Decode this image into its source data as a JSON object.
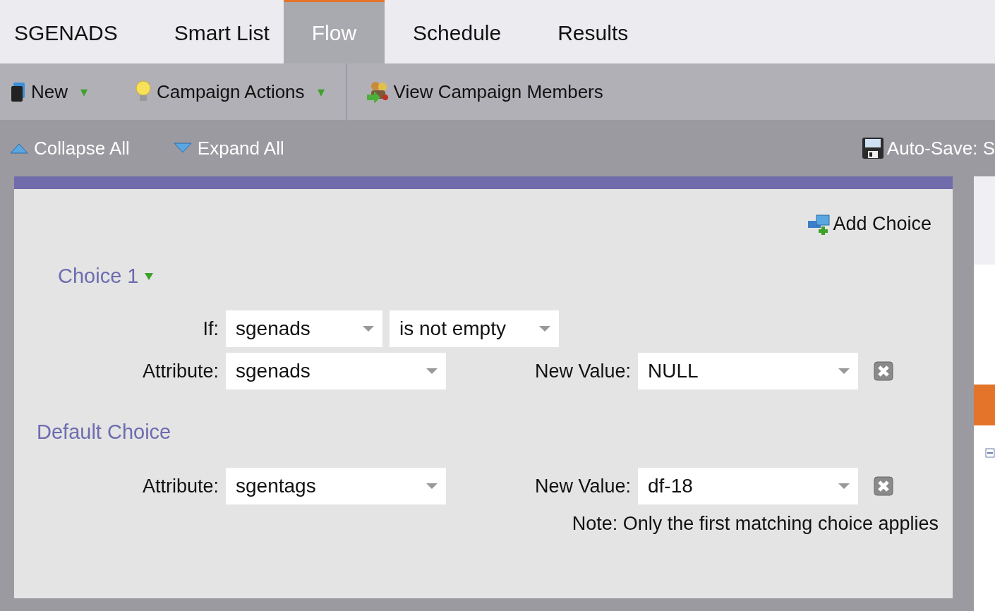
{
  "tabs": [
    {
      "label": "SGENADS",
      "selected": false
    },
    {
      "label": "Smart List",
      "selected": false
    },
    {
      "label": "Flow",
      "selected": true
    },
    {
      "label": "Schedule",
      "selected": false
    },
    {
      "label": "Results",
      "selected": false
    }
  ],
  "toolbar": [
    {
      "kind": "menu",
      "label": "New",
      "caret": "▾"
    },
    {
      "kind": "menu",
      "label": "Campaign Actions",
      "caret": "▾"
    },
    {
      "kind": "link",
      "label": "View Campaign Members"
    }
  ],
  "view_bar": {
    "collapse": "Collapse All",
    "expand": "Expand All",
    "autosave": "Auto-Save: S"
  },
  "panel": {
    "add_choice": "Add Choice",
    "choices": [
      {
        "title": "Choice 1",
        "if_label": "If:",
        "if_field": "sgenads",
        "if_operator": "is not empty",
        "attribute_label": "Attribute:",
        "attribute": "sgenads",
        "new_value_label": "New Value:",
        "new_value": "NULL"
      }
    ],
    "default": {
      "title": "Default Choice",
      "attribute_label": "Attribute:",
      "attribute": "sgentags",
      "new_value_label": "New Value:",
      "new_value": "df-18"
    },
    "note": "Note: Only the first matching choice applies"
  }
}
